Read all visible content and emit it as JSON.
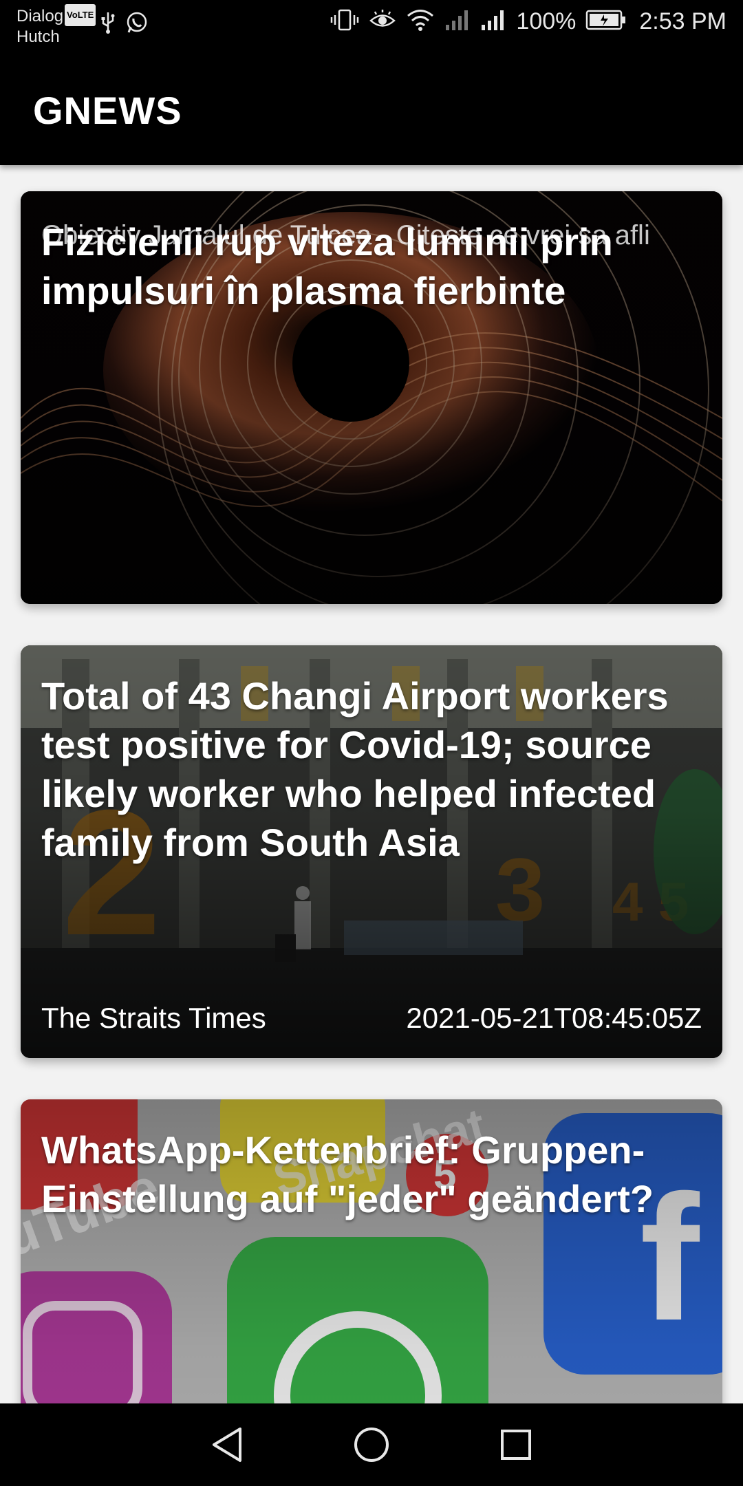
{
  "status_bar": {
    "carrier_line1": "Dialog",
    "volte": "VoLTE",
    "carrier_line2": "Hutch",
    "battery_percent": "100%",
    "time": "2:53 PM",
    "icons": [
      "usb-icon",
      "whatsapp-icon",
      "vibrate-icon",
      "eye-comfort-icon",
      "wifi-icon",
      "signal-icon",
      "signal-icon",
      "battery-charging-icon"
    ]
  },
  "app_bar": {
    "title": "GNEWS"
  },
  "articles": [
    {
      "title": "Fizicienii rup viteza luminii prin impulsuri în plasma fierbinte",
      "description": "Obiectiv Jurnalul de Tulcea - Citeste ce vrei sa afli",
      "source": "",
      "published_at": ""
    },
    {
      "title": "Total of 43 Changi Airport workers test positive for Covid-19; source likely worker who helped infected family from South Asia",
      "description": "",
      "source": "The Straits Times",
      "published_at": "2021-05-21T08:45:05Z"
    },
    {
      "title": "WhatsApp-Kettenbrief: Gruppen-Einstellung auf \"jeder\" geändert?",
      "description": "",
      "source": "",
      "published_at": ""
    }
  ],
  "nav_bar": {
    "icons": [
      "back-icon",
      "home-icon",
      "recents-icon"
    ]
  }
}
